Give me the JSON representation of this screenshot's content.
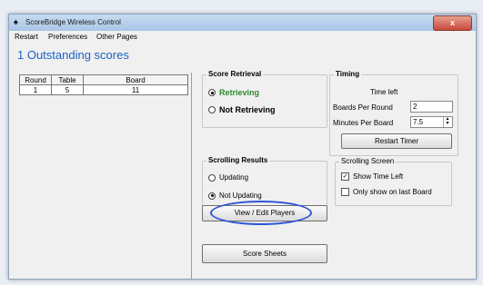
{
  "window": {
    "title": "ScoreBridge Wireless Control",
    "close_glyph": "x"
  },
  "menu": [
    "Restart",
    "Preferences",
    "Other Pages"
  ],
  "heading": "1 Outstanding scores",
  "table": {
    "columns": [
      "Round",
      "Table",
      "Board"
    ],
    "rows": [
      [
        "1",
        "5",
        "11"
      ]
    ]
  },
  "score_retrieval": {
    "title": "Score Retrieval",
    "options": [
      "Retrieving",
      "Not Retrieving"
    ],
    "selected": "Retrieving"
  },
  "timing": {
    "title": "Timing",
    "time_left_label": "Time left",
    "boards_per_round_label": "Boards Per Round",
    "boards_per_round_value": "2",
    "minutes_per_board_label": "Minutes Per Board",
    "minutes_per_board_value": "7.5",
    "restart_timer_label": "Restart Timer"
  },
  "scrolling_results": {
    "title": "Scrolling Results",
    "options": [
      "Updating",
      "Not Updating"
    ],
    "selected": "Not Updating"
  },
  "scrolling_screen": {
    "title": "Scrolling Screen",
    "show_time_left_label": "Show Time Left",
    "show_time_left_checked": true,
    "only_last_board_label": "Only show on last Board",
    "only_last_board_checked": false
  },
  "buttons": {
    "view_edit_players": "View / Edit Players",
    "score_sheets": "Score Sheets"
  },
  "colors": {
    "heading": "#1c62c4",
    "retrieving": "#2a8a2a",
    "highlight_ellipse": "#2f54d8"
  }
}
